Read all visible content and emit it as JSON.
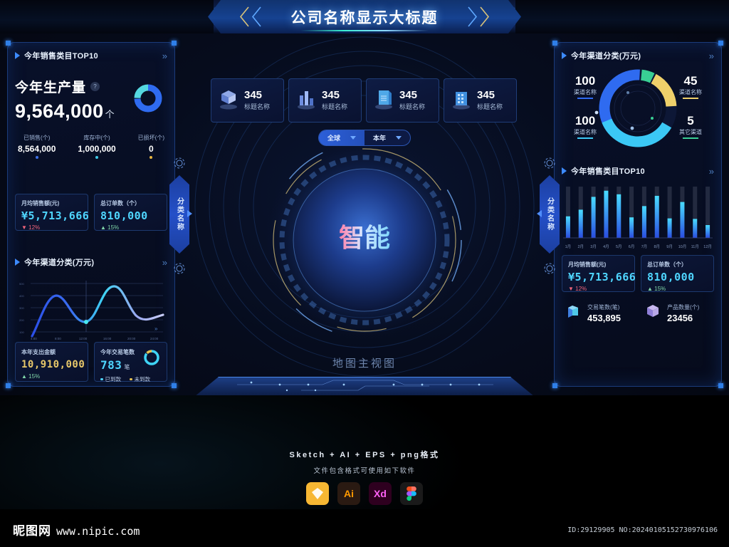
{
  "header": {
    "title": "公司名称显示大标题"
  },
  "top_stats": [
    {
      "value": "345",
      "label": "标题名称",
      "icon": "cube-stack-icon"
    },
    {
      "value": "345",
      "label": "标题名称",
      "icon": "bar-buildings-icon"
    },
    {
      "value": "345",
      "label": "标题名称",
      "icon": "document-server-icon"
    },
    {
      "value": "345",
      "label": "标题名称",
      "icon": "office-building-icon"
    }
  ],
  "filters": [
    {
      "label": "全球",
      "active": true
    },
    {
      "label": "本年",
      "active": false
    }
  ],
  "center": {
    "map_label": "地图主视图"
  },
  "left_panel": {
    "tab_label": "分类名称",
    "production": {
      "card_title": "今年销售类目TOP10",
      "more": "»",
      "heading": "今年生产量",
      "help": "?",
      "big_value": "9,564,000",
      "unit": "个",
      "breakdown": [
        {
          "label": "已销售(个)",
          "value": "8,564,000",
          "color": "#3d6fe8"
        },
        {
          "label": "库存中(个)",
          "value": "1,000,000",
          "color": "#3ec9e8"
        },
        {
          "label": "已损坏(个)",
          "value": "0",
          "color": "#e8b53e"
        }
      ]
    },
    "metrics": [
      {
        "label": "月均销售额(元)",
        "value": "¥5,713,666",
        "delta": "12%",
        "dir": "down",
        "color": "#4fd6ff"
      },
      {
        "label": "总订单数（个）",
        "value": "810,000",
        "delta": "15%",
        "dir": "up",
        "color": "#4fd6ff"
      }
    ],
    "channel_chart": {
      "card_title": "今年渠道分类(万元)",
      "more": "»"
    },
    "bottom_cards": [
      {
        "label": "本年支出金额",
        "value": "10,910,000",
        "delta": "15%",
        "dir": "up",
        "color": "#e8c86a"
      },
      {
        "label": "今年交易笔数",
        "value": "783",
        "unit": "笔",
        "legend": [
          {
            "label": "已到款",
            "color": "#4fd6ff"
          },
          {
            "label": "未到款",
            "color": "#e8c451"
          }
        ]
      }
    ]
  },
  "right_panel": {
    "tab_label": "分类名称",
    "donut": {
      "card_title": "今年渠道分类(万元)",
      "more": "»",
      "items": [
        {
          "value": "100",
          "label": "渠道名称",
          "color": "#2f6bf0",
          "side": "left"
        },
        {
          "value": "100",
          "label": "渠道名称",
          "color": "#3bc8f5",
          "side": "left"
        },
        {
          "value": "45",
          "label": "渠道名称",
          "color": "#efd06a",
          "side": "right"
        },
        {
          "value": "5",
          "label": "其它渠道",
          "color": "#39cf94",
          "side": "right"
        }
      ]
    },
    "bars": {
      "card_title": "今年销售类目TOP10",
      "more": "»"
    },
    "metrics": [
      {
        "label": "月均销售额(元)",
        "value": "¥5,713,666",
        "delta": "12%",
        "dir": "down"
      },
      {
        "label": "总订单数（个）",
        "value": "810,000",
        "delta": "15%",
        "dir": "up"
      }
    ],
    "kpis": [
      {
        "label": "交易笔数(笔)",
        "value": "453,895",
        "icon": "layers-icon"
      },
      {
        "label": "产品数量(个)",
        "value": "23456",
        "icon": "cube-icon"
      }
    ]
  },
  "footer": {
    "line1": "Sketch + AI + EPS + png格式",
    "line2": "文件包含格式可使用如下软件",
    "logos": [
      {
        "name": "sketch-logo",
        "text": "",
        "bg": "#f7b733"
      },
      {
        "name": "illustrator-logo",
        "text": "Ai",
        "bg": "#2a1a12",
        "fg": "#ff9a00"
      },
      {
        "name": "xd-logo",
        "text": "Xd",
        "bg": "#2e001f",
        "fg": "#ff61f6"
      },
      {
        "name": "figma-logo",
        "text": "",
        "bg": "#1a1a1a"
      }
    ]
  },
  "bottom_bar": {
    "brand": "昵图网",
    "url": "www.nipic.com",
    "id_text": "ID:29129905 NO:20240105152730976106"
  },
  "chart_data": [
    {
      "type": "line",
      "title": "今年渠道分类(万元)",
      "x": [
        "4:00",
        "8:00",
        "12:00",
        "16:00",
        "20:00",
        "24:00"
      ],
      "xlabel": "",
      "ylabel": "",
      "ylim": [
        0,
        600
      ],
      "ytick_labels": [
        "100",
        "200",
        "300",
        "400",
        "500"
      ],
      "grid": true,
      "series": [
        {
          "name": "渠道",
          "values": [
            60,
            400,
            300,
            180,
            430,
            200,
            150,
            230
          ]
        }
      ],
      "highlight_point": {
        "x": "12:00",
        "y": 180
      }
    },
    {
      "type": "pie",
      "title": "今年渠道分类(万元)",
      "labels": [
        "渠道名称",
        "渠道名称",
        "渠道名称",
        "其它渠道"
      ],
      "values": [
        100,
        100,
        45,
        5
      ],
      "colors": [
        "#2f6bf0",
        "#3bc8f5",
        "#efd06a",
        "#39cf94"
      ],
      "legend": "sides"
    },
    {
      "type": "bar",
      "title": "今年销售类目TOP10",
      "categories": [
        "1月",
        "2月",
        "3月",
        "4月",
        "5月",
        "6月",
        "7月",
        "8月",
        "9月",
        "10月",
        "11月",
        "12月"
      ],
      "values": [
        42,
        55,
        80,
        92,
        85,
        40,
        62,
        82,
        38,
        70,
        37,
        25
      ],
      "ylim": [
        0,
        100
      ],
      "xlabel": "",
      "ylabel": "",
      "grid": false,
      "bar_color": "#2fc6f5",
      "track_color": "#3a4258"
    },
    {
      "type": "pie",
      "title": "今年生产量",
      "labels": [
        "已销售(个)",
        "库存中(个)",
        "已损坏(个)"
      ],
      "values": [
        8564000,
        1000000,
        0
      ],
      "colors": [
        "#3d6fe8",
        "#3ec9e8",
        "#e8b53e"
      ]
    },
    {
      "type": "pie",
      "title": "今年交易笔数",
      "labels": [
        "已到款",
        "未到款"
      ],
      "values": [
        783,
        0
      ],
      "colors": [
        "#4fd6ff",
        "#e8c451"
      ]
    }
  ]
}
